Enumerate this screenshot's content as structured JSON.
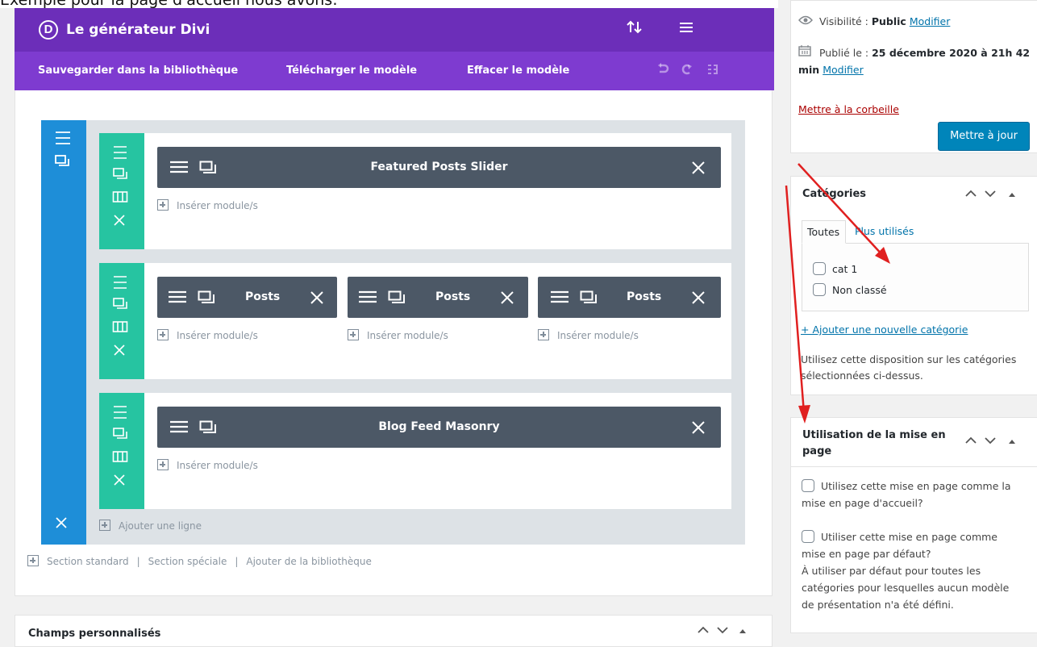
{
  "caption": "Exemple pour la page d'accueil nous avons:",
  "divi": {
    "logo_letter": "D",
    "title": "Le générateur Divi",
    "toolbar": {
      "save_library": "Sauvegarder dans la bibliothèque",
      "download_template": "Télécharger le modèle",
      "clear_template": "Effacer le modèle"
    },
    "rows": [
      {
        "modules": [
          {
            "title": "Featured Posts Slider"
          }
        ],
        "insert_label": "Insérer module/s"
      },
      {
        "modules": [
          {
            "title": "Posts"
          },
          {
            "title": "Posts"
          },
          {
            "title": "Posts"
          }
        ],
        "insert_label": "Insérer module/s"
      },
      {
        "modules": [
          {
            "title": "Blog Feed Masonry"
          }
        ],
        "insert_label": "Insérer module/s"
      }
    ],
    "add_row": "Ajouter une ligne",
    "bottom": {
      "standard_section": "Section standard",
      "special_section": "Section spéciale",
      "add_from_library": "Ajouter de la bibliothèque",
      "separator": "|"
    }
  },
  "custom_fields": {
    "title": "Champs personnalisés"
  },
  "publish": {
    "visibility_label": "Visibilité :",
    "visibility_value": "Public",
    "modify": "Modifier",
    "published_label": "Publié le :",
    "published_value": "25 décembre 2020 à 21h 42",
    "published_value_cont": "min",
    "trash": "Mettre à la corbeille",
    "update_button": "Mettre à jour"
  },
  "categories": {
    "title": "Catégories",
    "tab_all": "Toutes",
    "tab_most_used": "Plus utilisés",
    "items": [
      {
        "label": "cat 1"
      },
      {
        "label": "Non classé"
      }
    ],
    "add_new": "+ Ajouter une nouvelle catégorie",
    "help_line1": "Utilisez cette disposition sur les catégories",
    "help_line2": "sélectionnées ci-dessus."
  },
  "layout_usage": {
    "title_line1": "Utilisation de la mise en",
    "title_line2": "page",
    "opt1_line1": "Utilisez cette mise en page comme la",
    "opt1_line2": "mise en page d'accueil?",
    "opt2_line1": "Utiliser cette mise en page comme",
    "opt2_line2": "mise en page par défaut?",
    "desc_line1": "À utiliser par défaut pour toutes les",
    "desc_line2": "catégories pour lesquelles aucun modèle",
    "desc_line3": "de présentation n'a été défini."
  },
  "colors": {
    "divi_header": "#6c2eb9",
    "divi_toolbar": "#7e3bd0",
    "section": "#1e8ed8",
    "row": "#26c4a1",
    "module": "#4c5866",
    "wp_link": "#0073aa",
    "annotation_arrow": "#e02020"
  }
}
